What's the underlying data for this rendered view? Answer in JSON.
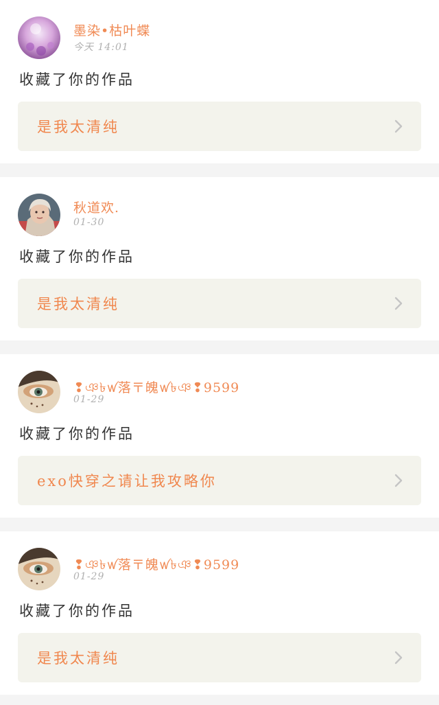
{
  "colors": {
    "page_bg": "#f4f4f4",
    "card_bg": "#ffffff",
    "username": "#f08a54",
    "time": "#b0b0b0",
    "action_text": "#333333",
    "work_box_bg": "#f3f3ec",
    "work_title": "#f0874e",
    "chevron": "#c4c4c4"
  },
  "notifications": [
    {
      "username": "墨染•枯叶蝶",
      "time": "今天 14:01",
      "action": "收藏了你的作品",
      "work_title": "是我太清纯",
      "avatar_icon": "purple-flower-avatar",
      "chevron_icon": "chevron-right-icon"
    },
    {
      "username": "秋道欢.",
      "time": "01-30",
      "action": "收藏了你的作品",
      "work_title": "是我太清纯",
      "avatar_icon": "girl-portrait-avatar",
      "chevron_icon": "chevron-right-icon"
    },
    {
      "username": "❢ঞ৳ꪝ落〒魄ꪝ৳ঞ❢9599",
      "time": "01-29",
      "action": "收藏了你的作品",
      "work_title": "exo快穿之请让我攻略你",
      "avatar_icon": "eye-makeup-avatar",
      "chevron_icon": "chevron-right-icon"
    },
    {
      "username": "❢ঞ৳ꪝ落〒魄ꪝ৳ঞ❢9599",
      "time": "01-29",
      "action": "收藏了你的作品",
      "work_title": "是我太清纯",
      "avatar_icon": "eye-makeup-avatar",
      "chevron_icon": "chevron-right-icon"
    }
  ]
}
